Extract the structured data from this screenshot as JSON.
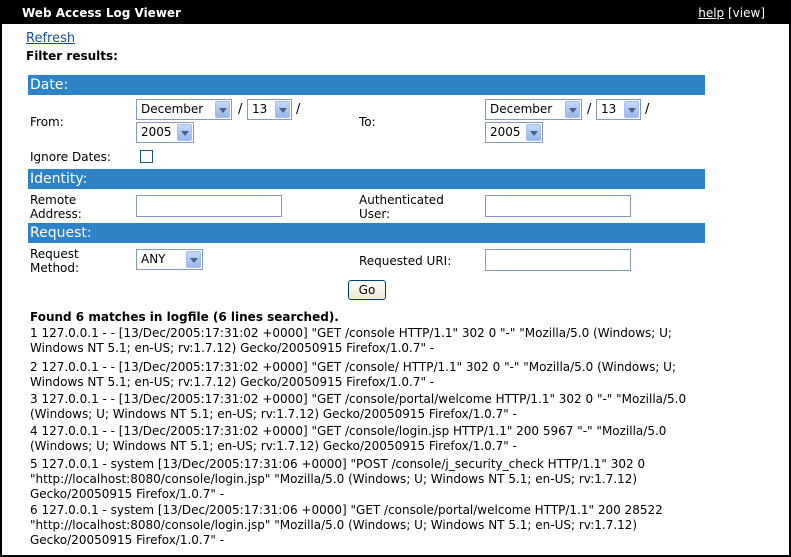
{
  "window": {
    "title": "Web Access Log Viewer",
    "help_link": "help",
    "view_link": "[view]"
  },
  "refresh_link": "Refresh",
  "filter_label": "Filter results:",
  "sections": {
    "date": "Date:",
    "identity": "Identity:",
    "request": "Request:"
  },
  "date": {
    "from_label": "From:",
    "to_label": "To:",
    "from": {
      "month": "December",
      "day": "13",
      "year": "2005"
    },
    "to": {
      "month": "December",
      "day": "13",
      "year": "2005"
    },
    "separator": "/",
    "ignore_dates_label": "Ignore Dates:",
    "ignore_dates_checked": false
  },
  "identity": {
    "remote_address_label_1": "Remote",
    "remote_address_label_2": "Address:",
    "remote_address_value": "",
    "auth_user_label_1": "Authenticated",
    "auth_user_label_2": "User:",
    "auth_user_value": ""
  },
  "request": {
    "method_label_1": "Request",
    "method_label_2": "Method:",
    "method_value": "ANY",
    "uri_label": "Requested URI:",
    "uri_value": ""
  },
  "go_button": "Go",
  "summary": "Found 6 matches in logfile (6 lines searched).",
  "log_entries": [
    {
      "line1": "1 127.0.0.1 - - [13/Dec/2005:17:31:02 +0000] \"GET /console HTTP/1.1\" 302 0 \"-\" \"Mozilla/5.0 (Windows; U;",
      "line2": "Windows NT 5.1; en-US; rv:1.7.12) Gecko/20050915 Firefox/1.0.7\" -"
    },
    {
      "line1": "2 127.0.0.1 - - [13/Dec/2005:17:31:02 +0000] \"GET /console/ HTTP/1.1\" 302 0 \"-\" \"Mozilla/5.0 (Windows; U;",
      "line2": "Windows NT 5.1; en-US; rv:1.7.12) Gecko/20050915 Firefox/1.0.7\" -"
    },
    {
      "line1": "3 127.0.0.1 - - [13/Dec/2005:17:31:02 +0000] \"GET /console/portal/welcome HTTP/1.1\" 302 0 \"-\" \"Mozilla/5.0",
      "line2": "(Windows; U; Windows NT 5.1; en-US; rv:1.7.12) Gecko/20050915 Firefox/1.0.7\" -"
    },
    {
      "line1": "4 127.0.0.1 - - [13/Dec/2005:17:31:02 +0000] \"GET /console/login.jsp HTTP/1.1\" 200 5967 \"-\" \"Mozilla/5.0",
      "line2": "(Windows; U; Windows NT 5.1; en-US; rv:1.7.12) Gecko/20050915 Firefox/1.0.7\" -"
    },
    {
      "line1": "5 127.0.0.1 - system [13/Dec/2005:17:31:06 +0000] \"POST /console/j_security_check HTTP/1.1\" 302 0",
      "line2": "\"http://localhost:8080/console/login.jsp\" \"Mozilla/5.0 (Windows; U; Windows NT 5.1; en-US; rv:1.7.12)",
      "line3": "Gecko/20050915 Firefox/1.0.7\" -"
    },
    {
      "line1": "6 127.0.0.1 - system [13/Dec/2005:17:31:06 +0000] \"GET /console/portal/welcome HTTP/1.1\" 200 28522",
      "line2": "\"http://localhost:8080/console/login.jsp\" \"Mozilla/5.0 (Windows; U; Windows NT 5.1; en-US; rv:1.7.12)",
      "line3": "Gecko/20050915 Firefox/1.0.7\" -"
    }
  ]
}
